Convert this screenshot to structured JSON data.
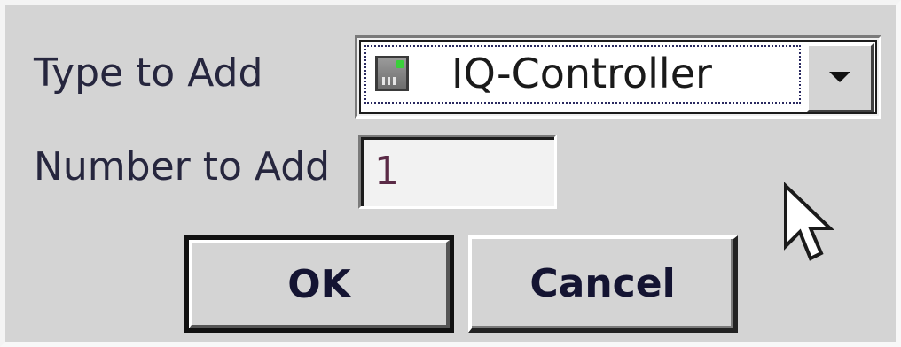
{
  "dialog": {
    "type_label": "Type to Add",
    "number_label": "Number to Add",
    "type_select": {
      "selected": "IQ-Controller",
      "icon": "controller-device-icon"
    },
    "number_input": {
      "value": "1"
    },
    "ok_label": "OK",
    "cancel_label": "Cancel"
  },
  "cursor": {
    "icon": "arrow-cursor-icon"
  }
}
